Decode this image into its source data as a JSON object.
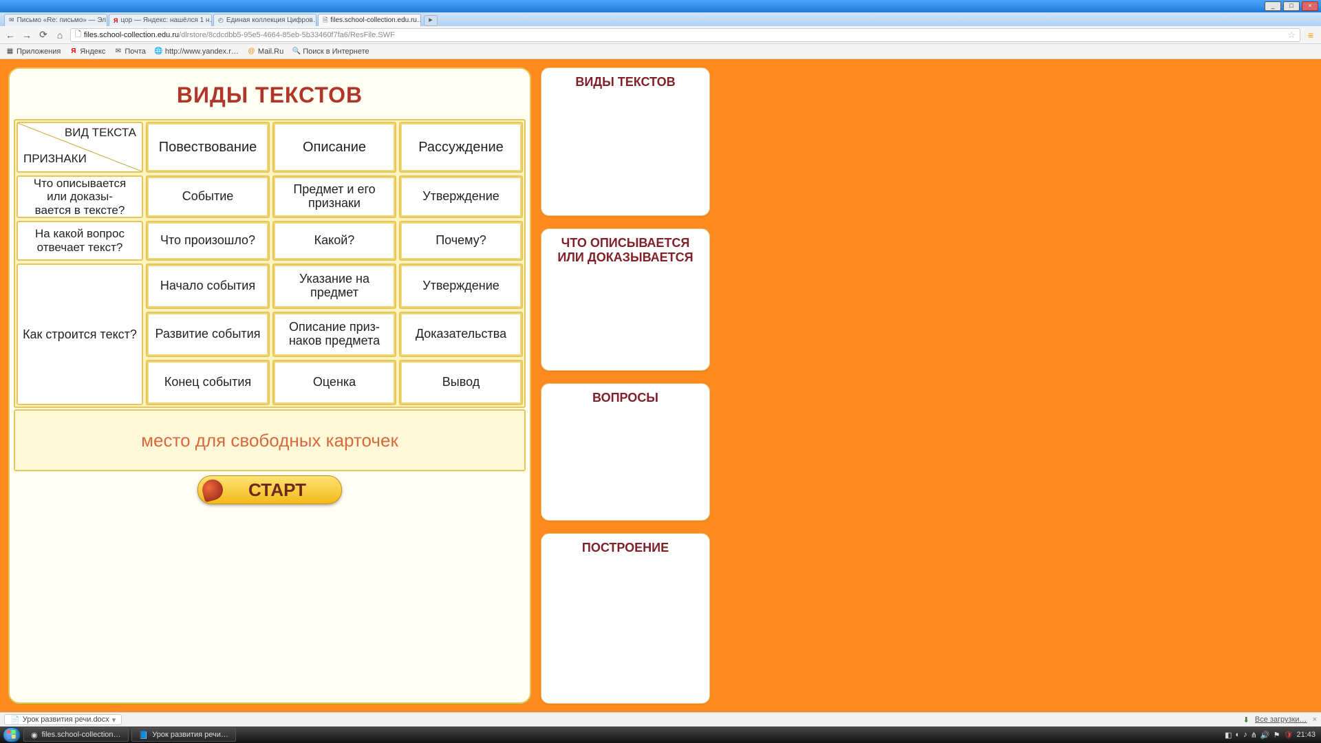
{
  "window": {
    "min": "_",
    "max": "□",
    "close": "×"
  },
  "tabs": {
    "0": {
      "label": "Письмо «Re: письмо» — Эл…"
    },
    "1": {
      "label": "цор — Яндекс: нашёлся 1 н…"
    },
    "2": {
      "label": "Единая коллекция Цифров…"
    },
    "3": {
      "label": "files.school-collection.edu.ru…"
    }
  },
  "toolbar": {
    "back": "←",
    "fwd": "→",
    "reload": "⟳",
    "home": "⌂",
    "url_host": "files.school-collection.edu.ru",
    "url_path": "/dlrstore/8cdcdbb5-95e5-4664-85eb-5b33460f7fa6/ResFile.SWF",
    "star": "☆",
    "menu": "≡"
  },
  "bookmarks": {
    "apps": "Приложения",
    "b0": "Яндекс",
    "b1": "Почта",
    "b2": "http://www.yandex.r…",
    "b3": "Mail.Ru",
    "b4": "Поиск в Интернете"
  },
  "app": {
    "title": "ВИДЫ ТЕКСТОВ",
    "hdr": {
      "diag_top": "ВИД ТЕКСТА",
      "diag_bottom": "ПРИЗНАКИ",
      "c1": "Повествование",
      "c2": "Описание",
      "c3": "Рассуждение"
    },
    "row1": {
      "label": "Что описывается или доказы-\nвается в тексте?",
      "c1": "Событие",
      "c2": "Предмет и его признаки",
      "c3": "Утверждение"
    },
    "row2": {
      "label": "На какой вопрос отвечает текст?",
      "c1": "Что произошло?",
      "c2": "Какой?",
      "c3": "Почему?"
    },
    "row3": {
      "label": "Как строится текст?",
      "r1c1": "Начало события",
      "r1c2": "Указание на предмет",
      "r1c3": "Утверждение",
      "r2c1": "Развитие события",
      "r2c2": "Описание приз-\nнаков предмета",
      "r2c3": "Доказательства",
      "r3c1": "Конец события",
      "r3c2": "Оценка",
      "r3c3": "Вывод"
    },
    "freecards": "место для  свободных карточек",
    "start": "СТАРТ",
    "side": {
      "s0": "ВИДЫ ТЕКСТОВ",
      "s1": "ЧТО ОПИСЫВАЕТСЯ ИЛИ ДОКАЗЫВАЕТСЯ",
      "s2": "ВОПРОСЫ",
      "s3": "ПОСТРОЕНИЕ"
    }
  },
  "download": {
    "file": "Урок развития речи.docx",
    "all": "Все загрузки…",
    "close": "×"
  },
  "taskbar": {
    "t0": "files.school-collection…",
    "t1": "Урок развития речи…",
    "clock": "21:43"
  }
}
